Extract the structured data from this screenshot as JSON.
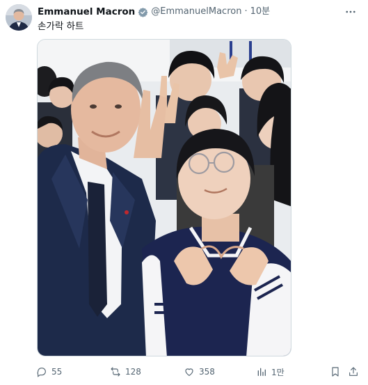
{
  "tweet": {
    "author_name": "Emmanuel Macron",
    "verified_icon": "verified-badge-icon",
    "handle": "@EmmanuelMacron",
    "separator": "·",
    "time": "10분",
    "text": "손가락 하트"
  },
  "actions": {
    "replies": "55",
    "reposts": "128",
    "likes": "358",
    "views": "1만"
  },
  "colors": {
    "text_primary": "#0f1419",
    "text_secondary": "#536471",
    "border": "#cfd9de",
    "verified": "#829aab"
  }
}
